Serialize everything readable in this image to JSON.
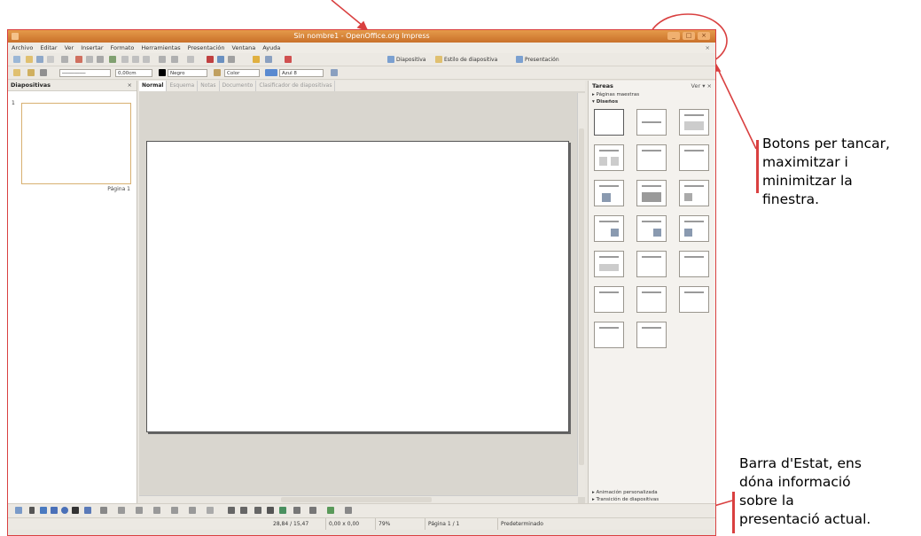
{
  "window": {
    "title": "Sin nombre1 - OpenOffice.org Impress",
    "window_buttons": [
      "_",
      "□",
      "×"
    ]
  },
  "menu": [
    "Archivo",
    "Editar",
    "Ver",
    "Insertar",
    "Formato",
    "Herramientas",
    "Presentación",
    "Ventana",
    "Ayuda"
  ],
  "toolbar": {
    "diapositiva": "Diapositiva",
    "estilo": "Estilo de diapositiva",
    "presentacion": "Presentación",
    "line_width": "0,00cm",
    "color_name": "Negro",
    "fill_mode": "Color",
    "fill_color": "Azul 8"
  },
  "slides_panel": {
    "title": "Diapositivas",
    "close": "×",
    "slide_number": "1",
    "slide_label": "Página 1"
  },
  "view_tabs": [
    {
      "label": "Normal",
      "active": true
    },
    {
      "label": "Esquema",
      "active": false
    },
    {
      "label": "Notas",
      "active": false
    },
    {
      "label": "Documento",
      "active": false
    },
    {
      "label": "Clasificador de diapositivas",
      "active": false
    }
  ],
  "tasks_panel": {
    "title": "Tareas",
    "view_menu": "Ver",
    "sections_top": [
      "Páginas maestras",
      "Diseños"
    ],
    "sections_bottom": [
      "Animación personalizada",
      "Transición de diapositivas"
    ]
  },
  "status_bar": {
    "position": "28,84 / 15,47",
    "size": "0,00 x 0,00",
    "zoom": "79%",
    "page": "Página 1 / 1",
    "master": "Predeterminado"
  },
  "annotations": {
    "window_buttons_note": [
      "Botons per tancar,",
      "maximitzar i",
      "minimitzar la",
      "finestra."
    ],
    "status_bar_note": [
      "Barra d'Estat, ens",
      "dóna informació",
      "sobre la",
      "presentació actual."
    ]
  },
  "colors": {
    "annotation": "#d94040",
    "titlebar": "#d8843a"
  }
}
